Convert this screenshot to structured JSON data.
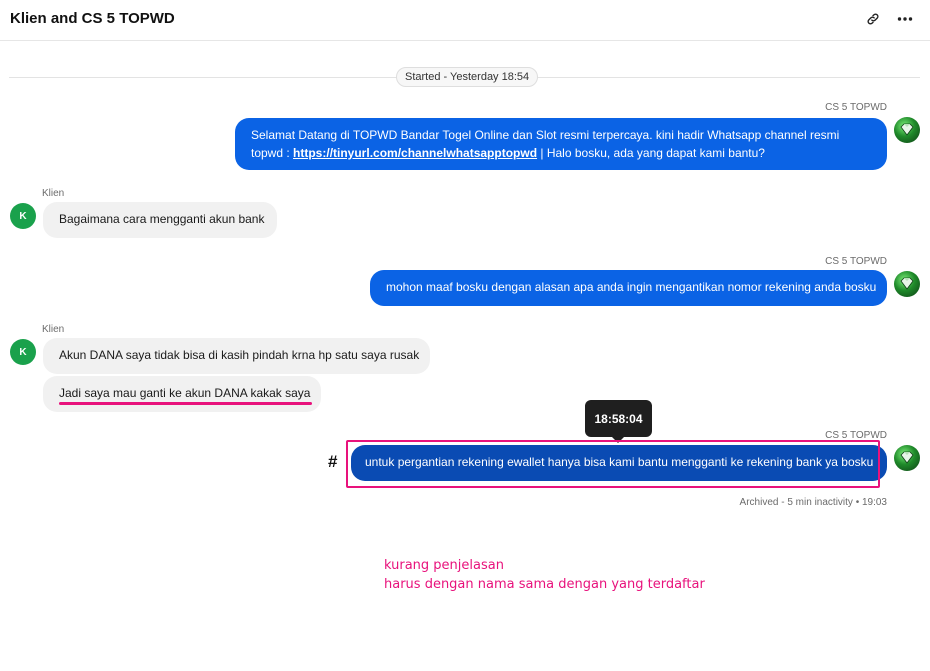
{
  "header": {
    "title": "Klien and CS 5 TOPWD",
    "link_icon": "link-icon",
    "more_icon": "more-horizontal-icon"
  },
  "conversation": {
    "started_label": "Started - Yesterday 18:54",
    "messages": [
      {
        "sender": "CS 5 TOPWD",
        "direction": "outgoing",
        "text_before_link": "Selamat Datang di TOPWD Bandar Togel Online dan Slot resmi terpercaya. kini hadir Whatsapp channel resmi topwd : ",
        "link_text": "https://tinyurl.com/channelwhatsapptopwd",
        "text_after_link": " | Halo bosku, ada yang dapat kami bantu?"
      },
      {
        "sender": "Klien",
        "direction": "incoming",
        "avatar_letter": "K",
        "text": "Bagaimana cara mengganti akun bank"
      },
      {
        "sender": "CS 5 TOPWD",
        "direction": "outgoing",
        "text": "mohon maaf bosku dengan alasan apa anda ingin mengantikan nomor rekening anda bosku"
      },
      {
        "sender": "Klien",
        "direction": "incoming",
        "avatar_letter": "K",
        "texts": [
          "Akun DANA saya tidak bisa di kasih pindah krna hp satu saya rusak",
          "Jadi saya mau ganti ke akun DANA kakak saya"
        ]
      },
      {
        "sender": "CS 5 TOPWD",
        "direction": "outgoing",
        "text": "untuk pergantian rekening ewallet hanya bisa kami bantu mengganti ke rekening bank ya bosku",
        "tooltip_time": "18:58:04"
      }
    ],
    "hash_marker": "#",
    "archived_label": "Archived - 5 min inactivity • 19:03"
  },
  "annotations": {
    "line1": "kurang penjelasan",
    "line2": "harus dengan nama sama dengan yang terdaftar"
  },
  "colors": {
    "outgoing_bubble": "#0b63e5",
    "incoming_bubble": "#f1f1f1",
    "client_avatar": "#1aa14c",
    "highlight": "#e8127c"
  }
}
